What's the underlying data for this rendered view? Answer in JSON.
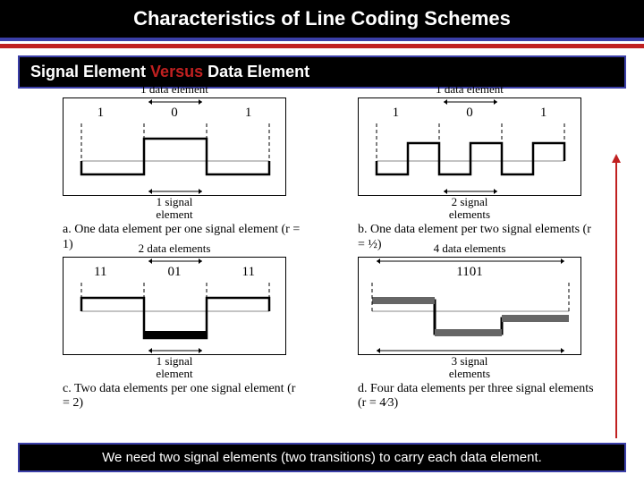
{
  "title": "Characteristics of Line Coding Schemes",
  "subtitle_pre": "Signal Element ",
  "subtitle_vs": "Versus",
  "subtitle_post": " Data Element",
  "panels": {
    "a": {
      "top": "1 data element",
      "bits": [
        "1",
        "0",
        "1"
      ],
      "bot1": "1 signal",
      "bot2": "element",
      "caption": "a. One data element per one signal element (r = 1)"
    },
    "b": {
      "top": "1 data element",
      "bits": [
        "1",
        "0",
        "1"
      ],
      "bot1": "2 signal",
      "bot2": "elements",
      "caption": "b. One data element per two signal elements (r = ½)"
    },
    "c": {
      "top": "2 data elements",
      "bits": [
        "11",
        "01",
        "11"
      ],
      "bot1": "1 signal",
      "bot2": "element",
      "caption": "c. Two data elements per one signal element (r = 2)"
    },
    "d": {
      "top": "4 data elements",
      "bits": [
        "1101"
      ],
      "bot1": "3 signal",
      "bot2": "elements",
      "caption": "d. Four data elements per three signal elements (r = 4⁄3)"
    }
  },
  "footer": "We need two signal elements (two transitions) to carry each data element."
}
